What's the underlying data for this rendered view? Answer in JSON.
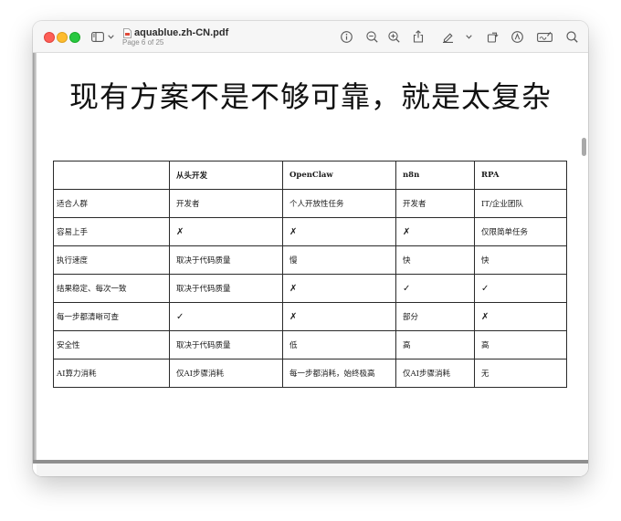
{
  "window": {
    "file_name": "aquablue.zh-CN.pdf",
    "page_indicator": "Page 6 of 25"
  },
  "toolbar": {
    "icons": [
      "sidebar-icon",
      "chevron-down-icon",
      "info-icon",
      "zoom-out-icon",
      "zoom-in-icon",
      "share-icon",
      "highlight-pen-icon",
      "chevron-down-icon",
      "rotate-icon",
      "markup-icon",
      "signature-form-icon",
      "search-icon"
    ]
  },
  "slide": {
    "title": "现有方案不是不够可靠，就是太复杂"
  },
  "table": {
    "headers": [
      "",
      "从头开发",
      "OpenClaw",
      "n8n",
      "RPA"
    ],
    "rows": [
      [
        "适合人群",
        "开发者",
        "个人开放性任务",
        "开发者",
        "IT/企业团队"
      ],
      [
        "容易上手",
        "✗",
        "✗",
        "✗",
        "仅限简单任务"
      ],
      [
        "执行速度",
        "取决于代码质量",
        "慢",
        "快",
        "快"
      ],
      [
        "结果稳定、每次一致",
        "取决于代码质量",
        "✗",
        "✓",
        "✓"
      ],
      [
        "每一步都清晰可查",
        "✓",
        "✗",
        "部分",
        "✗"
      ],
      [
        "安全性",
        "取决于代码质量",
        "低",
        "高",
        "高"
      ],
      [
        "AI算力消耗",
        "仅AI步骤消耗",
        "每一步都消耗，始终极高",
        "仅AI步骤消耗",
        "无"
      ]
    ]
  },
  "colors": {
    "close": "#fe5f57",
    "minimize": "#febc2e",
    "zoom": "#28c840",
    "toolbar_bg": "#f6f6f6",
    "table_border": "#2a2a2a"
  }
}
